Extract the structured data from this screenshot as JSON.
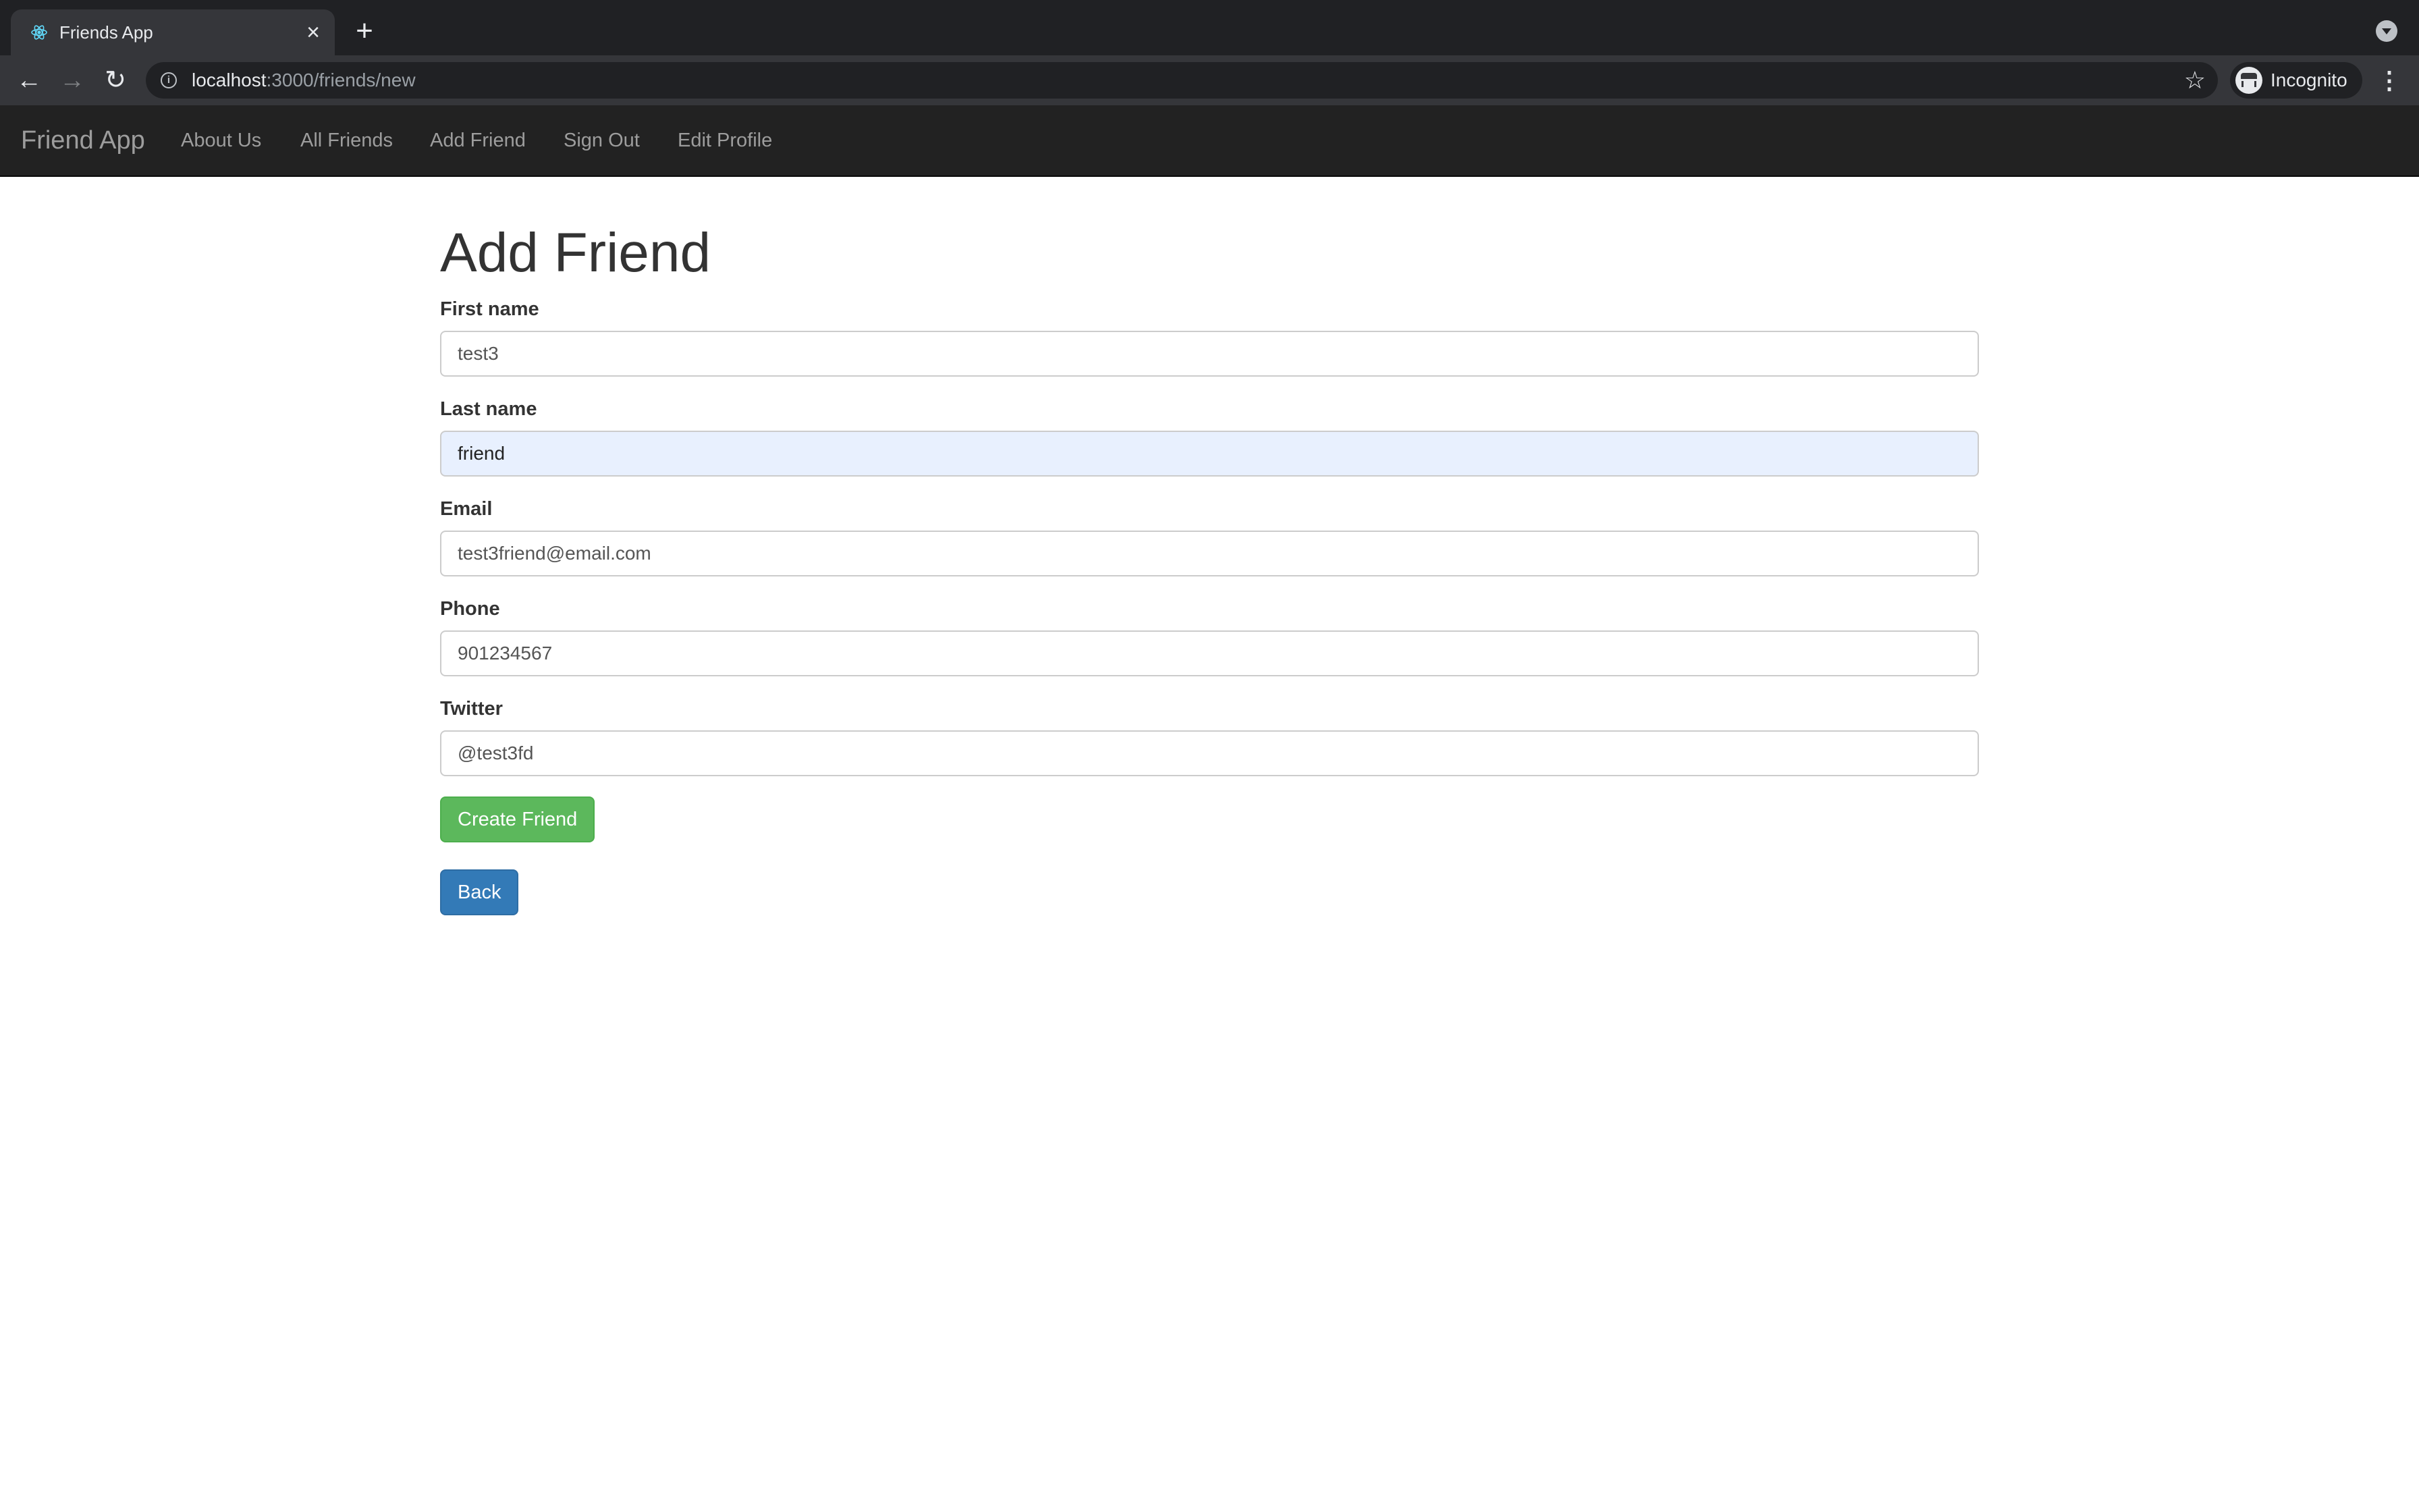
{
  "browser": {
    "tab_title": "Friends App",
    "url_host": "localhost",
    "url_path": ":3000/friends/new",
    "profile_label": "Incognito"
  },
  "navbar": {
    "brand": "Friend App",
    "links": [
      "About Us",
      "All Friends",
      "Add Friend",
      "Sign Out",
      "Edit Profile"
    ]
  },
  "page": {
    "title": "Add Friend",
    "fields": [
      {
        "label": "First name",
        "value": "test3"
      },
      {
        "label": "Last name",
        "value": "friend"
      },
      {
        "label": "Email",
        "value": "test3friend@email.com"
      },
      {
        "label": "Phone",
        "value": "901234567"
      },
      {
        "label": "Twitter",
        "value": "@test3fd"
      }
    ],
    "create_button": "Create Friend",
    "back_button": "Back"
  },
  "colors": {
    "navbar_bg": "#222222",
    "success": "#5cb85c",
    "primary": "#337ab7",
    "autofill_bg": "#e8f0fe"
  }
}
